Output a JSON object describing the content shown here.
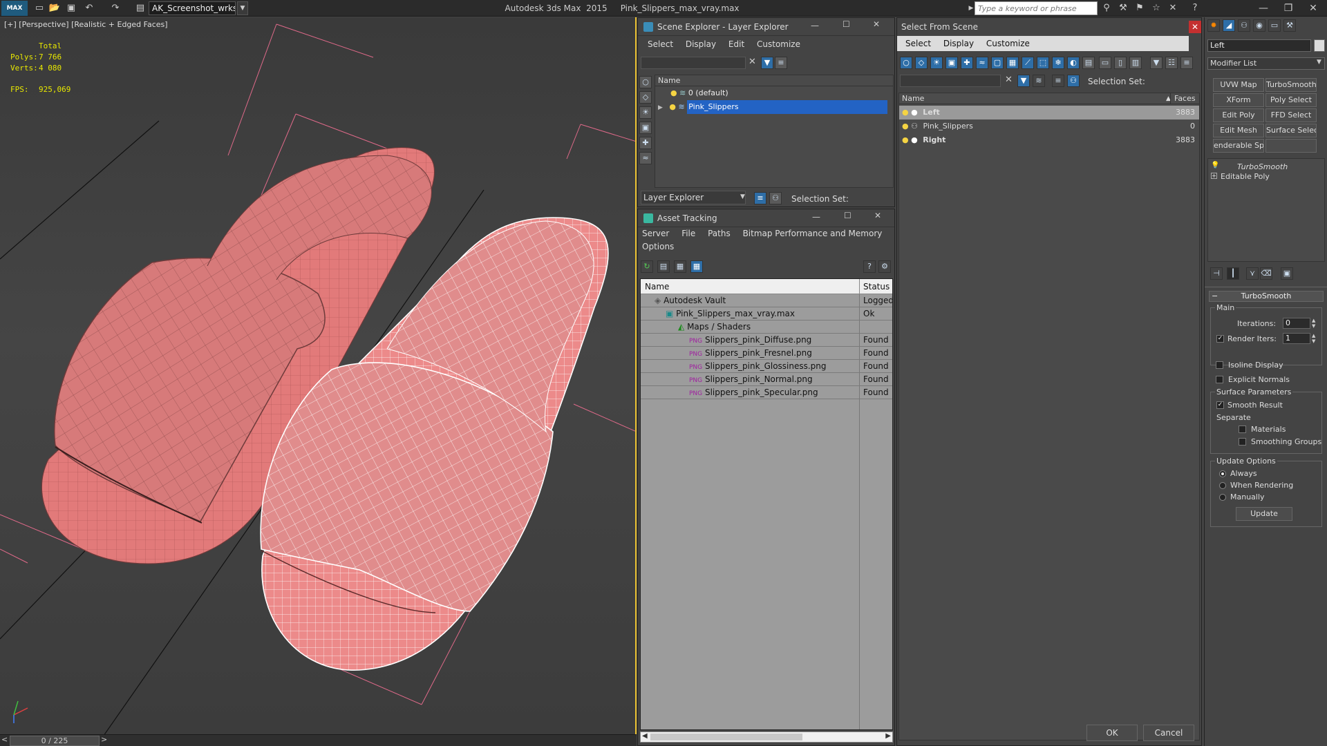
{
  "titlebar": {
    "logo": "MAX",
    "workspace": "AK_Screenshot_wrksp",
    "title": "Autodesk 3ds Max  2015     Pink_Slippers_max_vray.max",
    "search_placeholder": "Type a keyword or phrase"
  },
  "viewport": {
    "label": "[+] [Perspective] [Realistic + Edged Faces]",
    "stats": {
      "total_label": "Total",
      "polys_label": "Polys:",
      "polys_value": "7 766",
      "verts_label": "Verts:",
      "verts_value": "4 080",
      "fps_label": "FPS:",
      "fps_value": "925,069"
    },
    "time_slider": "0 / 225"
  },
  "scene_explorer": {
    "title": "Scene Explorer - Layer Explorer",
    "menu": [
      "Select",
      "Display",
      "Edit",
      "Customize"
    ],
    "column": "Name",
    "rows": [
      {
        "name": "0 (default)"
      },
      {
        "name": "Pink_Slippers"
      }
    ],
    "footer_dropdown": "Layer Explorer",
    "selection_set_label": "Selection Set:"
  },
  "asset_tracking": {
    "title": "Asset Tracking",
    "menu": [
      "Server",
      "File",
      "Paths",
      "Bitmap Performance and Memory"
    ],
    "menu2": "Options",
    "col_name": "Name",
    "col_status": "Status",
    "rows": [
      {
        "name": "Autodesk Vault",
        "status": "Logged",
        "indent": 0
      },
      {
        "name": "Pink_Slippers_max_vray.max",
        "status": "Ok",
        "indent": 1
      },
      {
        "name": "Maps / Shaders",
        "status": "",
        "indent": 2
      },
      {
        "name": "Slippers_pink_Diffuse.png",
        "status": "Found",
        "indent": 3
      },
      {
        "name": "Slippers_pink_Fresnel.png",
        "status": "Found",
        "indent": 3
      },
      {
        "name": "Slippers_pink_Glossiness.png",
        "status": "Found",
        "indent": 3
      },
      {
        "name": "Slippers_pink_Normal.png",
        "status": "Found",
        "indent": 3
      },
      {
        "name": "Slippers_pink_Specular.png",
        "status": "Found",
        "indent": 3
      }
    ]
  },
  "select_from_scene": {
    "title": "Select From Scene",
    "menu": [
      "Select",
      "Display",
      "Customize"
    ],
    "selection_set_label": "Selection Set:",
    "col_name": "Name",
    "col_faces": "Faces",
    "rows": [
      {
        "name": "Left",
        "faces": "3883",
        "bold": true,
        "selected": true
      },
      {
        "name": "Pink_Slippers",
        "faces": "0",
        "bold": false,
        "selected": false
      },
      {
        "name": "Right",
        "faces": "3883",
        "bold": true,
        "selected": false
      }
    ],
    "ok": "OK",
    "cancel": "Cancel"
  },
  "command_panel": {
    "object_name": "Left",
    "modifier_list": "Modifier List",
    "buttons": [
      "UVW Map",
      "TurboSmooth",
      "XForm",
      "Poly Select",
      "Edit Poly",
      "FFD Select",
      "Edit Mesh",
      "Surface Select",
      "enderable Splir",
      ""
    ],
    "stack": [
      "TurboSmooth",
      "Editable Poly"
    ],
    "rollout_title": "TurboSmooth",
    "main_label": "Main",
    "iterations_label": "Iterations:",
    "iterations_value": "0",
    "render_iters_label": "Render Iters:",
    "render_iters_value": "1",
    "isoline_label": "Isoline Display",
    "explicit_label": "Explicit Normals",
    "surface_label": "Surface Parameters",
    "smooth_label": "Smooth Result",
    "separate_label": "Separate",
    "materials_label": "Materials",
    "smoothing_label": "Smoothing Groups",
    "update_options_label": "Update Options",
    "always_label": "Always",
    "when_rendering_label": "When Rendering",
    "manually_label": "Manually",
    "update_button": "Update"
  }
}
